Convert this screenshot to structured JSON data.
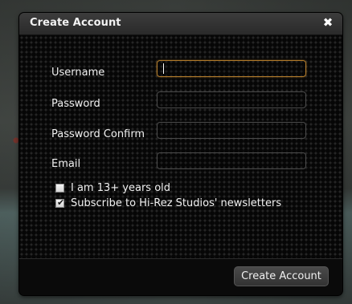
{
  "dialog": {
    "title": "Create Account",
    "close_glyph": "✖"
  },
  "form": {
    "username_label": "Username",
    "username_value": "",
    "password_label": "Password",
    "password_value": "",
    "password_confirm_label": "Password Confirm",
    "password_confirm_value": "",
    "email_label": "Email",
    "email_value": ""
  },
  "checks": [
    {
      "label": "I am 13+ years old",
      "checked": false
    },
    {
      "label": "Subscribe to Hi-Rez Studios' newsletters",
      "checked": true
    }
  ],
  "footer": {
    "submit_label": "Create Account"
  },
  "colors": {
    "focus_border": "#b07a2a",
    "dialog_bg": "#0d0d0d"
  }
}
